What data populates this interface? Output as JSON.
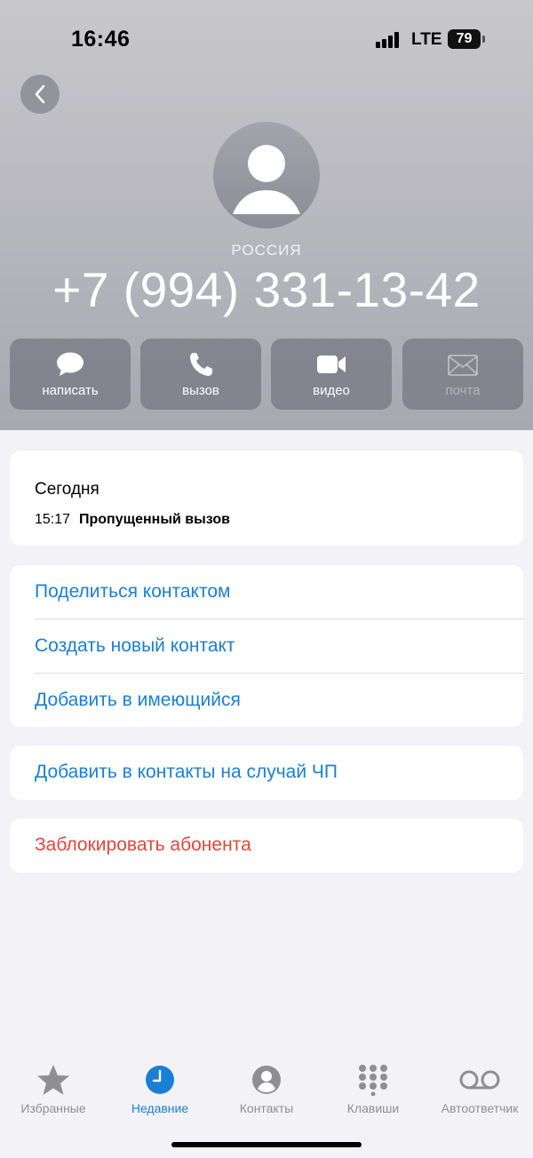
{
  "status_bar": {
    "time": "16:46",
    "network": "LTE",
    "battery": "79"
  },
  "contact": {
    "country": "РОССИЯ",
    "phone": "+7 (994) 331-13-42"
  },
  "actions": [
    {
      "label": "написать",
      "icon": "message-icon",
      "enabled": true
    },
    {
      "label": "вызов",
      "icon": "phone-icon",
      "enabled": true
    },
    {
      "label": "видео",
      "icon": "video-icon",
      "enabled": true
    },
    {
      "label": "почта",
      "icon": "mail-icon",
      "enabled": false
    }
  ],
  "recent": {
    "title": "Сегодня",
    "time": "15:17",
    "type": "Пропущенный вызов"
  },
  "menu": {
    "share": "Поделиться контактом",
    "create": "Создать новый контакт",
    "add_existing": "Добавить в имеющийся",
    "emergency": "Добавить в контакты на случай ЧП",
    "block": "Заблокировать абонента"
  },
  "tabs": [
    {
      "label": "Избранные",
      "icon": "star-icon",
      "active": false
    },
    {
      "label": "Недавние",
      "icon": "clock-icon",
      "active": true
    },
    {
      "label": "Контакты",
      "icon": "person-circle-icon",
      "active": false
    },
    {
      "label": "Клавиши",
      "icon": "keypad-icon",
      "active": false
    },
    {
      "label": "Автоответчик",
      "icon": "voicemail-icon",
      "active": false
    }
  ],
  "colors": {
    "accent": "#1a7fd6",
    "destructive": "#e5453a",
    "background": "#f2f2f7"
  }
}
